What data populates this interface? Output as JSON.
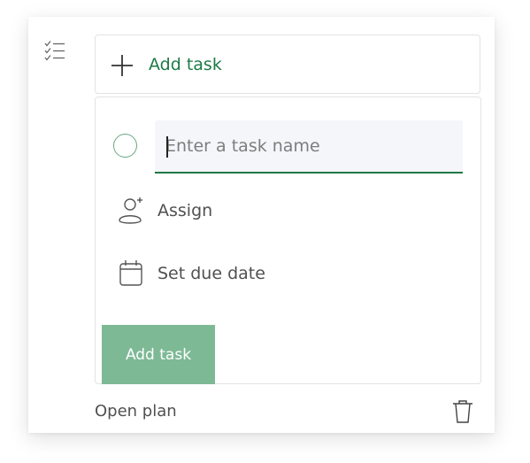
{
  "add_task_bar": {
    "label": "Add task",
    "icon": "plus-icon"
  },
  "sidebar": {
    "icon": "checklist-icon"
  },
  "form": {
    "task_name_placeholder": "Enter a task name",
    "task_name_value": "",
    "assign_label": "Assign",
    "assign_icon": "assign-user-icon",
    "due_date_label": "Set due date",
    "due_date_icon": "calendar-icon",
    "submit_label": "Add task"
  },
  "footer": {
    "open_plan_label": "Open plan",
    "delete_icon": "trash-icon"
  },
  "colors": {
    "accent": "#1e7a46",
    "button": "#7eb996",
    "radio_border": "#6aa784",
    "input_bg": "#f4f6f9"
  }
}
